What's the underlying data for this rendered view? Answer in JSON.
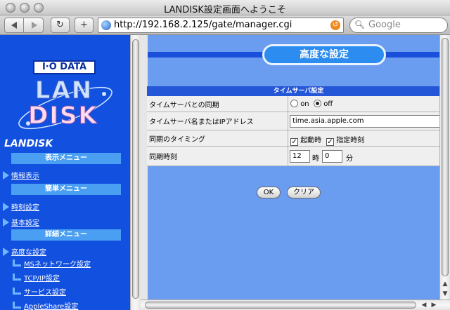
{
  "window": {
    "title": "LANDISK設定画面へようこそ"
  },
  "toolbar": {
    "back_icon": "back-arrow-icon",
    "forward_icon": "forward-arrow-icon",
    "reload_glyph": "↻",
    "add_glyph": "+",
    "url": "http://192.168.2.125/gate/manager.cgi",
    "search_placeholder": "Google"
  },
  "sidebar": {
    "brand": "I·O DATA",
    "logo_line1": "LAN",
    "logo_line2": "DISK",
    "heading": "LANDISK",
    "sections": {
      "display_menu": "表示メニュー",
      "simple_menu": "簡単メニュー",
      "detail_menu": "詳細メニュー"
    },
    "links": {
      "info": "情報表示",
      "time": "時刻設定",
      "basic": "基本設定",
      "advanced": "高度な設定"
    },
    "sublinks": {
      "ms_network": "MSネットワーク設定",
      "tcpip": "TCP/IP設定",
      "service": "サービス設定",
      "appleshare": "AppleShare設定"
    }
  },
  "main": {
    "page_title": "高度な設定",
    "section_title": "タイムサーバ設定",
    "rows": {
      "sync_label": "タイムサーバとの同期",
      "sync_on": "on",
      "sync_off": "off",
      "server_label": "タイムサーバ名またはIPアドレス",
      "server_value": "time.asia.apple.com",
      "timing_label": "同期のタイミング",
      "timing_boot": "起動時",
      "timing_scheduled": "指定時刻",
      "time_label": "同期時刻",
      "hour_value": "12",
      "hour_unit": "時",
      "minute_value": "0",
      "minute_unit": "分"
    },
    "buttons": {
      "ok": "OK",
      "clear": "クリア"
    }
  },
  "colors": {
    "sidebar_bg": "#1250e0",
    "content_bg": "#6a9cf0",
    "menu_header": "#4a9ff2",
    "banner": "#2d8cf0"
  }
}
